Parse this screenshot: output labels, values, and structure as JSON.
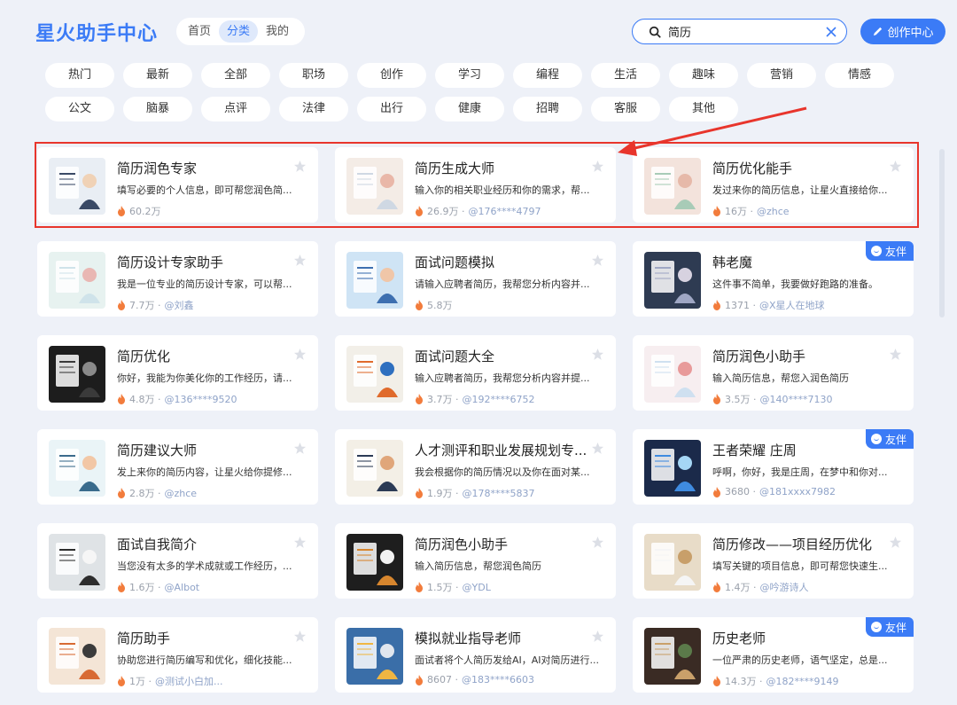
{
  "header": {
    "logo": "星火助手中心",
    "nav": [
      {
        "label": "首页",
        "active": false
      },
      {
        "label": "分类",
        "active": true
      },
      {
        "label": "我的",
        "active": false
      }
    ],
    "search": {
      "value": "简历",
      "icon": "search-icon"
    },
    "create_button": "创作中心"
  },
  "categories": {
    "row1": [
      "热门",
      "最新",
      "全部",
      "职场",
      "创作",
      "学习",
      "编程",
      "生活",
      "趣味",
      "营销",
      "情感"
    ],
    "row2": [
      "公文",
      "脑暴",
      "点评",
      "法律",
      "出行",
      "健康",
      "招聘",
      "客服",
      "其他"
    ]
  },
  "badge_label": "友伴",
  "colors": {
    "accent": "#3b7bf6",
    "highlight": "#e8352c",
    "background": "#eef1f8"
  },
  "cards": [
    {
      "title": "简历润色专家",
      "desc": "填写必要的个人信息，即可帮您润色简...",
      "count": "60.2万",
      "author": "",
      "badge": false
    },
    {
      "title": "简历生成大师",
      "desc": "输入你的相关职业经历和你的需求，帮...",
      "count": "26.9万",
      "author": "@176****4797",
      "badge": false
    },
    {
      "title": "简历优化能手",
      "desc": "发过来你的简历信息，让星火直接给你...",
      "count": "16万",
      "author": "@zhce",
      "badge": false
    },
    {
      "title": "简历设计专家助手",
      "desc": "我是一位专业的简历设计专家，可以帮...",
      "count": "7.7万",
      "author": "@刘鑫",
      "badge": false
    },
    {
      "title": "面试问题模拟",
      "desc": "请输入应聘者简历，我帮您分析内容并...",
      "count": "5.8万",
      "author": "",
      "badge": false
    },
    {
      "title": "韩老魔",
      "desc": "这件事不简单，我要做好跑路的准备。",
      "count": "1371",
      "author": "@X星人在地球",
      "badge": true
    },
    {
      "title": "简历优化",
      "desc": "你好，我能为你美化你的工作经历，请...",
      "count": "4.8万",
      "author": "@136****9520",
      "badge": false
    },
    {
      "title": "面试问题大全",
      "desc": "输入应聘者简历，我帮您分析内容并提...",
      "count": "3.7万",
      "author": "@192****6752",
      "badge": false
    },
    {
      "title": "简历润色小助手",
      "desc": "输入简历信息，帮您入润色简历",
      "count": "3.5万",
      "author": "@140****7130",
      "badge": false
    },
    {
      "title": "简历建议大师",
      "desc": "发上来你的简历内容，让星火给你提修...",
      "count": "2.8万",
      "author": "@zhce",
      "badge": false
    },
    {
      "title": "人才测评和职业发展规划专...",
      "desc": "我会根据你的简历情况以及你在面对某...",
      "count": "1.9万",
      "author": "@178****5837",
      "badge": false
    },
    {
      "title": "王者荣耀 庄周",
      "desc": "呼啊，你好，我是庄周，在梦中和你对...",
      "count": "3680",
      "author": "@181xxxx7982",
      "badge": true
    },
    {
      "title": "面试自我简介",
      "desc": "当您没有太多的学术成就或工作经历，...",
      "count": "1.6万",
      "author": "@Albot",
      "badge": false
    },
    {
      "title": "简历润色小助手",
      "desc": "输入简历信息，帮您润色简历",
      "count": "1.5万",
      "author": "@YDL",
      "badge": false
    },
    {
      "title": "简历修改——项目经历优化",
      "desc": "填写关键的项目信息，即可帮您快速生...",
      "count": "1.4万",
      "author": "@吟游诗人",
      "badge": false
    },
    {
      "title": "简历助手",
      "desc": "协助您进行简历编写和优化，细化技能...",
      "count": "1万",
      "author": "@测试小白加...",
      "badge": false
    },
    {
      "title": "模拟就业指导老师",
      "desc": "面试者将个人简历发给AI，AI对简历进行...",
      "count": "8607",
      "author": "@183****6603",
      "badge": false
    },
    {
      "title": "历史老师",
      "desc": "一位严肃的历史老师，语气坚定，总是...",
      "count": "14.3万",
      "author": "@182****9149",
      "badge": true
    }
  ]
}
